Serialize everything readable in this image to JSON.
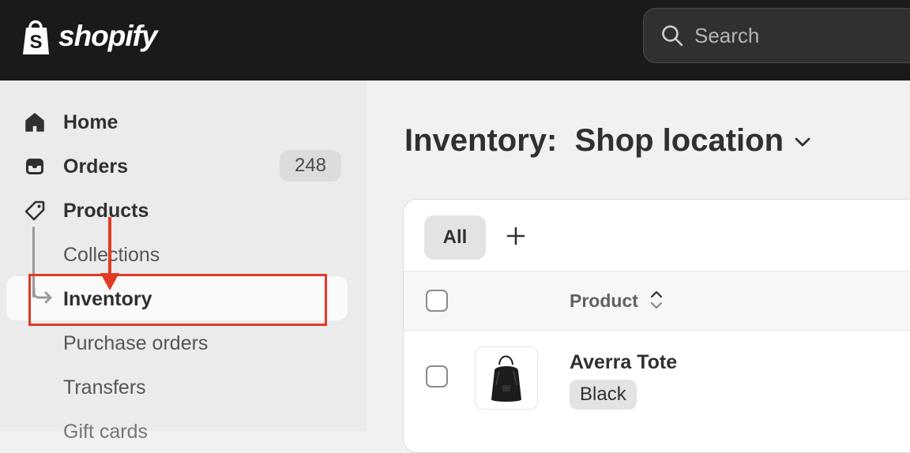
{
  "topbar": {
    "logo_text": "shopify",
    "search_placeholder": "Search"
  },
  "sidebar": {
    "items": [
      {
        "label": "Home",
        "icon": "home-icon"
      },
      {
        "label": "Orders",
        "icon": "inbox-icon",
        "badge": "248"
      },
      {
        "label": "Products",
        "icon": "tag-icon"
      }
    ],
    "sub_items": [
      {
        "label": "Collections"
      },
      {
        "label": "Inventory",
        "active": true
      },
      {
        "label": "Purchase orders"
      },
      {
        "label": "Transfers"
      },
      {
        "label": "Gift cards"
      }
    ]
  },
  "main": {
    "title": "Inventory:  Shop location",
    "tabs": [
      {
        "label": "All"
      }
    ],
    "table": {
      "columns": [
        "Product"
      ],
      "rows": [
        {
          "product": "Averra Tote",
          "variant": "Black"
        }
      ]
    }
  },
  "colors": {
    "annotation": "#e23a24",
    "topbar": "#1a1a1a"
  }
}
